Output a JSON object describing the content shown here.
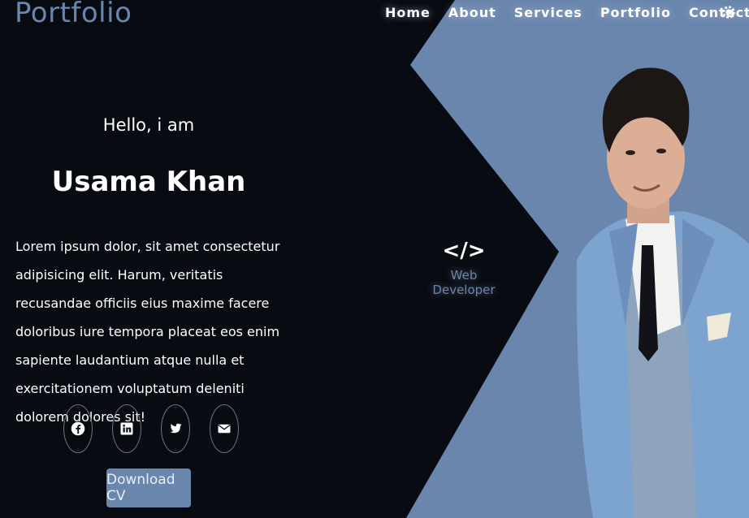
{
  "brand": {
    "logo": "Portfolio"
  },
  "nav": {
    "items": [
      {
        "label": "Home"
      },
      {
        "label": "About"
      },
      {
        "label": "Services"
      },
      {
        "label": "Portfolio"
      },
      {
        "label": "Contact"
      }
    ],
    "theme_toggle_icon": "gear-icon"
  },
  "hero": {
    "greeting": "Hello, i am",
    "name": "Usama Khan",
    "bio": "Lorem ipsum dolor, sit amet consectetur adipisicing elit. Harum, veritatis recusandae officiis eius maxime facere doloribus iure tempora placeat eos enim sapiente laudantium atque nulla et exercitationem voluptatum deleniti dolorem dolores sit!",
    "socials": [
      {
        "icon": "facebook-icon"
      },
      {
        "icon": "linkedin-icon"
      },
      {
        "icon": "twitter-icon"
      },
      {
        "icon": "envelope-icon"
      }
    ],
    "cv_button": "Download CV",
    "role_icon": "</>",
    "role": "Web Developer"
  },
  "colors": {
    "accent": "#6a86ad",
    "background": "#080b12",
    "text": "#ffffff"
  }
}
